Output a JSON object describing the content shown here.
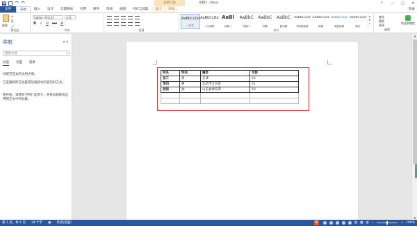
{
  "window": {
    "title": "文档1 - Word",
    "context_tab_group": "表格工具",
    "controls": [
      "?",
      "—",
      "□",
      "✕"
    ]
  },
  "tabs": [
    {
      "label": "文件",
      "kind": "file"
    },
    {
      "label": "开始",
      "kind": "active"
    },
    {
      "label": "插入",
      "kind": "normal"
    },
    {
      "label": "设计",
      "kind": "normal"
    },
    {
      "label": "页面布局",
      "kind": "normal"
    },
    {
      "label": "引用",
      "kind": "normal"
    },
    {
      "label": "邮件",
      "kind": "normal"
    },
    {
      "label": "审阅",
      "kind": "normal"
    },
    {
      "label": "视图",
      "kind": "normal"
    },
    {
      "label": "PDF工具集",
      "kind": "normal"
    },
    {
      "label": "设计",
      "kind": "ctx"
    },
    {
      "label": "布局",
      "kind": "ctx"
    }
  ],
  "login_label": "登录",
  "ribbon": {
    "clipboard": {
      "paste": "粘贴",
      "label": "剪贴板",
      "cut": "✂",
      "copy": "⎘",
      "format_painter": "🖌"
    },
    "font": {
      "name": "Calibri (中文正)",
      "size": "五号",
      "label": "字体",
      "bold": "B",
      "italic": "I",
      "underline": "U",
      "strike": "abc",
      "color": "A"
    },
    "paragraph": {
      "label": "段落"
    },
    "styles": {
      "label": "样式",
      "items": [
        {
          "sample": "AaBbCcDd",
          "name": "↵正文",
          "selected": true
        },
        {
          "sample": "AaBbCcDd",
          "name": "↵无间隔",
          "selected": false
        },
        {
          "sample": "AaBl",
          "name": "标题 1",
          "selected": false
        },
        {
          "sample": "AaBbC",
          "name": "标题 2",
          "selected": false
        },
        {
          "sample": "AaBbC",
          "name": "标题",
          "selected": false
        },
        {
          "sample": "AaBbC",
          "name": "副标题",
          "selected": false
        },
        {
          "sample": "AaBbCcDd",
          "name": "不明显强调",
          "selected": false
        },
        {
          "sample": "AaBbCcDd",
          "name": "强调",
          "selected": false
        },
        {
          "sample": "AaBbCcDd",
          "name": "明显强调",
          "selected": false
        },
        {
          "sample": "AaBbCcDd",
          "name": "要点",
          "selected": false
        }
      ]
    },
    "editing": {
      "find": "查找",
      "replace": "替换",
      "select": "选择",
      "label": "编辑"
    },
    "extra": {
      "label": "发送到微信"
    }
  },
  "nav": {
    "title": "导航",
    "search_placeholder": "搜索文档",
    "tabs": [
      "标题",
      "页面",
      "结果"
    ],
    "text1": "创建交互式的文档大纲。",
    "text2": "它是跟踪所在位置或快速移动内容的好方式。",
    "text3": "要开始，请转到\"开始\"选项卡，并将标题样式应用到正文中的标题。"
  },
  "table": {
    "headers": [
      "姓名",
      "性别",
      "籍贯",
      "年龄"
    ],
    "rows": [
      [
        "张三",
        "男",
        "天津",
        "23"
      ],
      [
        "李四",
        "男",
        "北京市大兴区",
        "21"
      ],
      [
        "钱钱",
        "女",
        "山东省青岛市",
        "18"
      ]
    ],
    "empty_rows": 2
  },
  "status": {
    "page": "第 1 页，共 1 页",
    "words": "34 个字",
    "lang": "英语(美国)",
    "zoom": "100%"
  },
  "colors": {
    "brand": "#2b579a",
    "highlight": "#e03a3a",
    "context": "#c2703a"
  }
}
